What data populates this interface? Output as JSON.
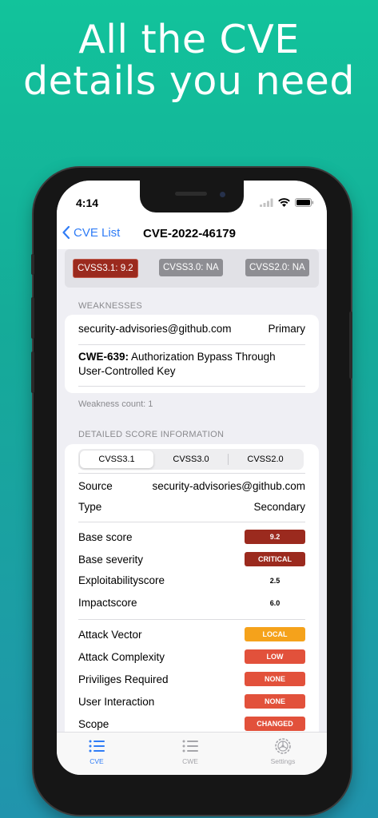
{
  "headline": {
    "line1": "All the CVE",
    "line2": "details you need"
  },
  "status_bar": {
    "time": "4:14"
  },
  "nav": {
    "back_label": "CVE List",
    "title": "CVE-2022-46179"
  },
  "cvss_badges": [
    {
      "label": "CVSS3.1: 9.2",
      "color": "#9b2a1e"
    },
    {
      "label": "CVSS3.0: NA",
      "color": "#8e8e93"
    },
    {
      "label": "CVSS2.0: NA",
      "color": "#8e8e93"
    }
  ],
  "weaknesses": {
    "header": "WEAKNESSES",
    "source": "security-advisories@github.com",
    "type": "Primary",
    "cwe_id": "CWE-639:",
    "cwe_desc_line1": "Authorization Bypass Through",
    "cwe_desc_line2": "User-Controlled Key",
    "count_text": "Weakness count: 1"
  },
  "detailed": {
    "header": "DETAILED SCORE INFORMATION",
    "tabs": [
      "CVSS3.1",
      "CVSS3.0",
      "CVSS2.0"
    ],
    "active_tab": "CVSS3.1",
    "source_label": "Source",
    "source_value": "security-advisories@github.com",
    "type_label": "Type",
    "type_value": "Secondary",
    "scores": [
      {
        "label": "Base score",
        "value": "9.2",
        "color": "#9b2a1e"
      },
      {
        "label": "Base severity",
        "value": "CRITICAL",
        "color": "#9b2a1e"
      },
      {
        "label": "Exploitabilityscore",
        "value": "2.5"
      },
      {
        "label": "Impactscore",
        "value": "6.0"
      }
    ],
    "metrics": [
      {
        "label": "Attack Vector",
        "value": "LOCAL",
        "color": "#f5a21b"
      },
      {
        "label": "Attack Complexity",
        "value": "LOW",
        "color": "#e2513b"
      },
      {
        "label": "Priviliges Required",
        "value": "NONE",
        "color": "#e2513b"
      },
      {
        "label": "User Interaction",
        "value": "NONE",
        "color": "#e2513b"
      },
      {
        "label": "Scope",
        "value": "CHANGED",
        "color": "#e2513b"
      }
    ]
  },
  "tab_bar": {
    "items": [
      {
        "label": "CVE",
        "icon": "list-icon",
        "active": true
      },
      {
        "label": "CWE",
        "icon": "list-icon",
        "active": false
      },
      {
        "label": "Settings",
        "icon": "gear-icon",
        "active": false
      }
    ],
    "accent_color": "#2f7cf6",
    "inactive_color": "#a5a5aa"
  }
}
